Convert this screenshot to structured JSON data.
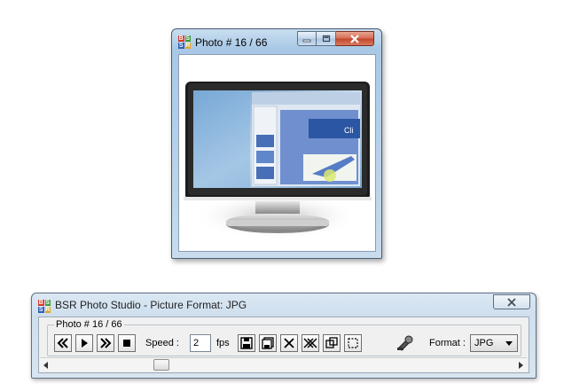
{
  "photo_window": {
    "title": "Photo # 16 / 66",
    "icons": {
      "logo": "bsr-logo-icon",
      "minimize": "minimize-icon",
      "maximize": "maximize-icon",
      "close": "close-icon"
    },
    "logo_letters": [
      "B",
      "S",
      "S",
      "R"
    ]
  },
  "toolbar_window": {
    "title": "BSR Photo Studio - Picture Format: JPG",
    "group_label": "Photo # 16 / 66",
    "speed_label": "Speed :",
    "speed_value": "2",
    "fps_label": "fps",
    "format_label": "Format :",
    "format_value": "JPG",
    "icons": {
      "first": "rewind-icon",
      "play": "play-icon",
      "next": "fast-forward-icon",
      "stop": "stop-icon",
      "save": "save-icon",
      "save_copy": "save-copy-icon",
      "delete": "delete-icon",
      "delete_all": "delete-all-icon",
      "resize": "resize-icon",
      "select": "select-region-icon",
      "settings": "settings-icon",
      "close": "close-icon",
      "scroll_left": "scroll-left-icon",
      "scroll_right": "scroll-right-icon"
    },
    "scroll_position": 0.23
  },
  "colors": {
    "window_frame": "#4a5d73",
    "close_button": "#c2452a",
    "client_bg": "#f0f0f0",
    "logo_red": "#d33a2c",
    "logo_green": "#3f9a3b",
    "logo_blue": "#2f5fb5",
    "logo_yellow": "#e6a81e"
  }
}
